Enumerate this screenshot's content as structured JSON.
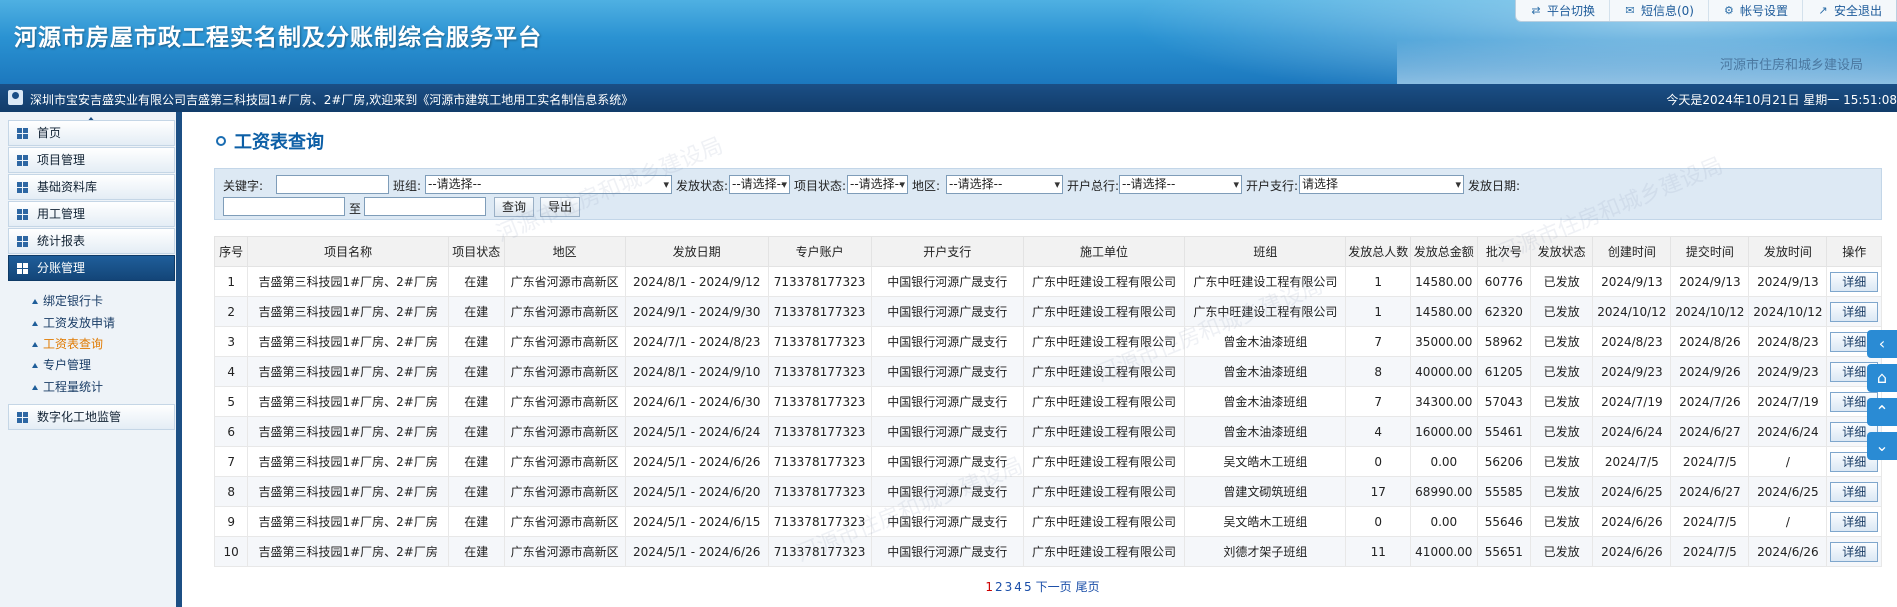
{
  "header": {
    "title": "河源市房屋市政工程实名制及分账制综合服务平台",
    "dept": "河源市住房和城乡建设局",
    "topnav": [
      {
        "label": "平台切换",
        "icon": "switch-icon"
      },
      {
        "label": "短信息(0)",
        "icon": "mail-icon"
      },
      {
        "label": "帐号设置",
        "icon": "gear-icon"
      },
      {
        "label": "安全退出",
        "icon": "logout-icon"
      }
    ]
  },
  "infobar": {
    "welcome": "深圳市宝安吉盛实业有限公司吉盛第三科技园1#厂房、2#厂房,欢迎来到《河源市建筑工地用工实名制信息系统》",
    "date": "今天是2024年10月21日 星期一 15:51:08"
  },
  "sidebar": {
    "menu": [
      {
        "label": "首页"
      },
      {
        "label": "项目管理"
      },
      {
        "label": "基础资料库"
      },
      {
        "label": "用工管理"
      },
      {
        "label": "统计报表"
      },
      {
        "label": "分账管理"
      }
    ],
    "sub": [
      {
        "label": "绑定银行卡"
      },
      {
        "label": "工资发放申请"
      },
      {
        "label": "工资表查询"
      },
      {
        "label": "专户管理"
      },
      {
        "label": "工程量统计"
      }
    ],
    "last": {
      "label": "数字化工地监管"
    }
  },
  "page": {
    "title": "工资表查询"
  },
  "filter": {
    "keyword_label": "关键字:",
    "team_label": "班组:",
    "team_value": "--请选择--",
    "pay_status_label": "发放状态:",
    "pay_status_value": "--请选择--",
    "proj_status_label": "项目状态:",
    "proj_status_value": "--请选择--",
    "region_label": "地区:",
    "region_value": "--请选择--",
    "bank_label": "开户总行:",
    "bank_value": "--请选择--",
    "branch_label": "开户支行:",
    "branch_value": "请选择",
    "date_label": "发放日期:",
    "to_label": "至",
    "query_label": "查询",
    "export_label": "导出"
  },
  "table": {
    "headers": [
      "序号",
      "项目名称",
      "项目状态",
      "地区",
      "发放日期",
      "专户账户",
      "开户支行",
      "施工单位",
      "班组",
      "发放总人数",
      "发放总金额",
      "批次号",
      "发放状态",
      "创建时间",
      "提交时间",
      "发放时间",
      "操作"
    ],
    "detail_label": "详细",
    "rows": [
      [
        "1",
        "吉盛第三科技园1#厂房、2#厂房",
        "在建",
        "广东省河源市高新区",
        "2024/8/1 - 2024/9/12",
        "713378177323",
        "中国银行河源广晟支行",
        "广东中旺建设工程有限公司",
        "广东中旺建设工程有限公司",
        "1",
        "14580.00",
        "60776",
        "已发放",
        "2024/9/13",
        "2024/9/13",
        "2024/9/13"
      ],
      [
        "2",
        "吉盛第三科技园1#厂房、2#厂房",
        "在建",
        "广东省河源市高新区",
        "2024/9/1 - 2024/9/30",
        "713378177323",
        "中国银行河源广晟支行",
        "广东中旺建设工程有限公司",
        "广东中旺建设工程有限公司",
        "1",
        "14580.00",
        "62320",
        "已发放",
        "2024/10/12",
        "2024/10/12",
        "2024/10/12"
      ],
      [
        "3",
        "吉盛第三科技园1#厂房、2#厂房",
        "在建",
        "广东省河源市高新区",
        "2024/7/1 - 2024/8/23",
        "713378177323",
        "中国银行河源广晟支行",
        "广东中旺建设工程有限公司",
        "曾金木油漆班组",
        "7",
        "35000.00",
        "58962",
        "已发放",
        "2024/8/23",
        "2024/8/26",
        "2024/8/23"
      ],
      [
        "4",
        "吉盛第三科技园1#厂房、2#厂房",
        "在建",
        "广东省河源市高新区",
        "2024/8/1 - 2024/9/10",
        "713378177323",
        "中国银行河源广晟支行",
        "广东中旺建设工程有限公司",
        "曾金木油漆班组",
        "8",
        "40000.00",
        "61205",
        "已发放",
        "2024/9/23",
        "2024/9/26",
        "2024/9/23"
      ],
      [
        "5",
        "吉盛第三科技园1#厂房、2#厂房",
        "在建",
        "广东省河源市高新区",
        "2024/6/1 - 2024/6/30",
        "713378177323",
        "中国银行河源广晟支行",
        "广东中旺建设工程有限公司",
        "曾金木油漆班组",
        "7",
        "34300.00",
        "57043",
        "已发放",
        "2024/7/19",
        "2024/7/26",
        "2024/7/19"
      ],
      [
        "6",
        "吉盛第三科技园1#厂房、2#厂房",
        "在建",
        "广东省河源市高新区",
        "2024/5/1 - 2024/6/24",
        "713378177323",
        "中国银行河源广晟支行",
        "广东中旺建设工程有限公司",
        "曾金木油漆班组",
        "4",
        "16000.00",
        "55461",
        "已发放",
        "2024/6/24",
        "2024/6/27",
        "2024/6/24"
      ],
      [
        "7",
        "吉盛第三科技园1#厂房、2#厂房",
        "在建",
        "广东省河源市高新区",
        "2024/5/1 - 2024/6/26",
        "713378177323",
        "中国银行河源广晟支行",
        "广东中旺建设工程有限公司",
        "吴文皓木工班组",
        "0",
        "0.00",
        "56206",
        "已发放",
        "2024/7/5",
        "2024/7/5",
        "/"
      ],
      [
        "8",
        "吉盛第三科技园1#厂房、2#厂房",
        "在建",
        "广东省河源市高新区",
        "2024/5/1 - 2024/6/20",
        "713378177323",
        "中国银行河源广晟支行",
        "广东中旺建设工程有限公司",
        "曾建文砌筑班组",
        "17",
        "68990.00",
        "55585",
        "已发放",
        "2024/6/25",
        "2024/6/27",
        "2024/6/25"
      ],
      [
        "9",
        "吉盛第三科技园1#厂房、2#厂房",
        "在建",
        "广东省河源市高新区",
        "2024/5/1 - 2024/6/15",
        "713378177323",
        "中国银行河源广晟支行",
        "广东中旺建设工程有限公司",
        "吴文皓木工班组",
        "0",
        "0.00",
        "55646",
        "已发放",
        "2024/6/26",
        "2024/7/5",
        "/"
      ],
      [
        "10",
        "吉盛第三科技园1#厂房、2#厂房",
        "在建",
        "广东省河源市高新区",
        "2024/5/1 - 2024/6/26",
        "713378177323",
        "中国银行河源广晟支行",
        "广东中旺建设工程有限公司",
        "刘德才架子班组",
        "11",
        "41000.00",
        "55651",
        "已发放",
        "2024/6/26",
        "2024/7/5",
        "2024/6/26"
      ]
    ]
  },
  "pager": {
    "pages": [
      "1",
      "2",
      "3",
      "4",
      "5"
    ],
    "next_label": "下一页",
    "last_label": "尾页"
  },
  "float_nav": [
    {
      "icon": "chevron-left-icon",
      "glyph": "‹"
    },
    {
      "icon": "home-icon",
      "glyph": "⌂"
    },
    {
      "icon": "arrow-up-icon",
      "glyph": "⌃"
    },
    {
      "icon": "arrow-down-icon",
      "glyph": "⌄"
    }
  ],
  "colors": {
    "header": "#2a92d2",
    "infobar": "#1b4f86",
    "active_menu": "#1f5e9a",
    "title": "#0d5fa6",
    "current_sub": "#e07a00"
  }
}
